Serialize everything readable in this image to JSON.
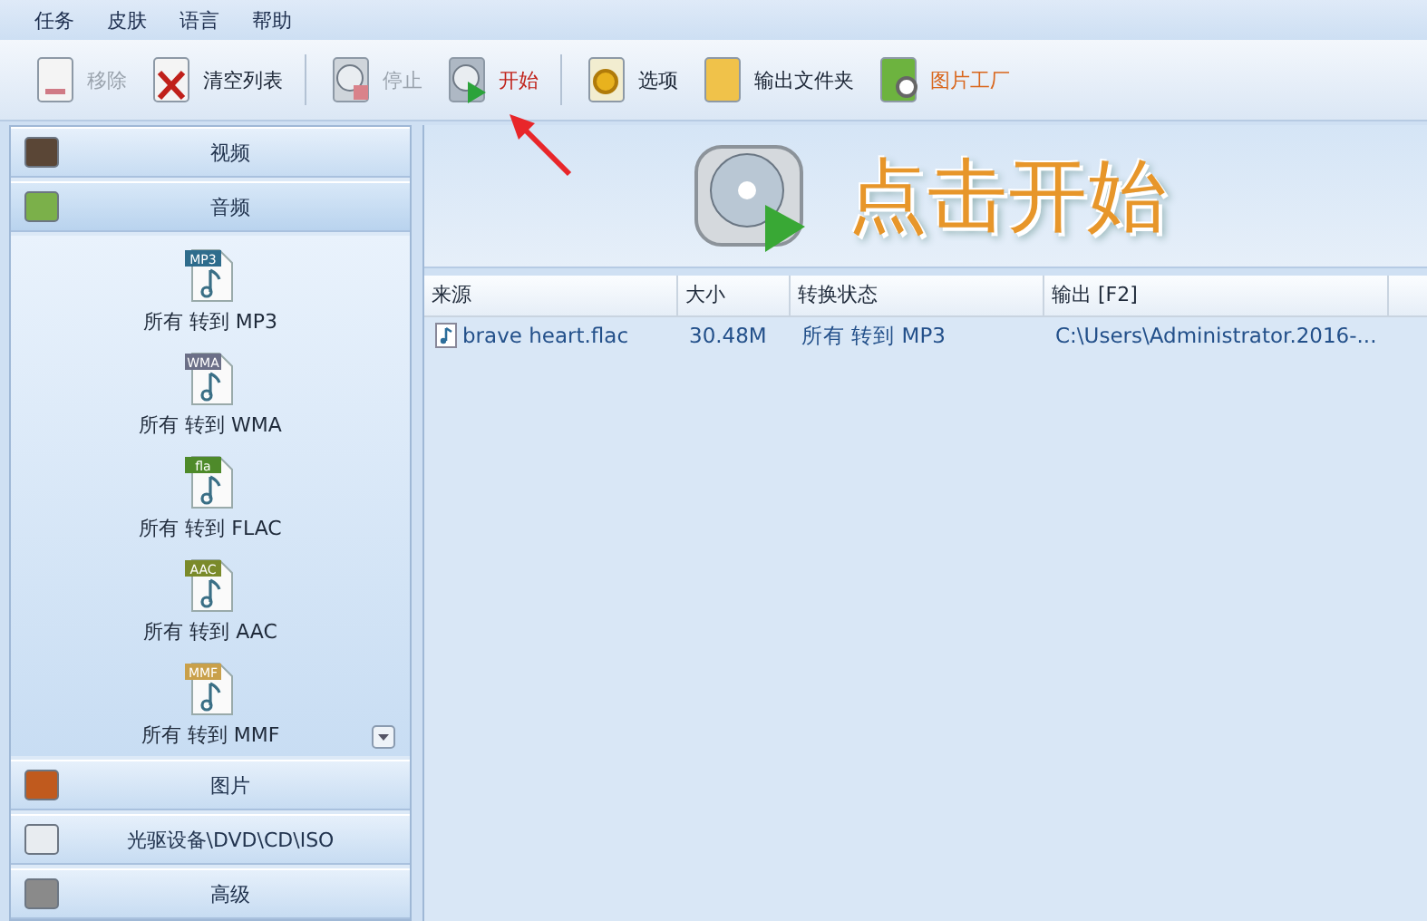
{
  "menu": [
    "任务",
    "皮肤",
    "语言",
    "帮助"
  ],
  "toolbar": [
    {
      "label": "移除",
      "kind": "normal",
      "disabled": true
    },
    {
      "label": "清空列表",
      "kind": "normal",
      "disabled": false
    },
    {
      "label": "停止",
      "kind": "normal",
      "disabled": true
    },
    {
      "label": "开始",
      "kind": "accent",
      "disabled": false
    },
    {
      "label": "选项",
      "kind": "normal",
      "disabled": false
    },
    {
      "label": "输出文件夹",
      "kind": "normal",
      "disabled": false
    },
    {
      "label": "图片工厂",
      "kind": "link",
      "disabled": false
    }
  ],
  "categories": [
    {
      "label": "视频",
      "expanded": false
    },
    {
      "label": "音频",
      "expanded": true,
      "items": [
        {
          "badge": "MP3",
          "label": "所有 转到 MP3"
        },
        {
          "badge": "WMA",
          "label": "所有 转到 WMA"
        },
        {
          "badge": "fla",
          "label": "所有 转到 FLAC"
        },
        {
          "badge": "AAC",
          "label": "所有 转到 AAC"
        },
        {
          "badge": "MMF",
          "label": "所有 转到 MMF"
        }
      ]
    },
    {
      "label": "图片",
      "expanded": false
    },
    {
      "label": "光驱设备\\DVD\\CD\\ISO",
      "expanded": false
    },
    {
      "label": "高级",
      "expanded": false
    }
  ],
  "banner": {
    "text": "点击开始"
  },
  "table": {
    "columns": [
      "来源",
      "大小",
      "转换状态",
      "输出 [F2]"
    ],
    "rows": [
      [
        "brave heart.flac",
        "30.48M",
        "所有 转到 MP3",
        "C:\\Users\\Administrator.2016-..."
      ]
    ]
  }
}
